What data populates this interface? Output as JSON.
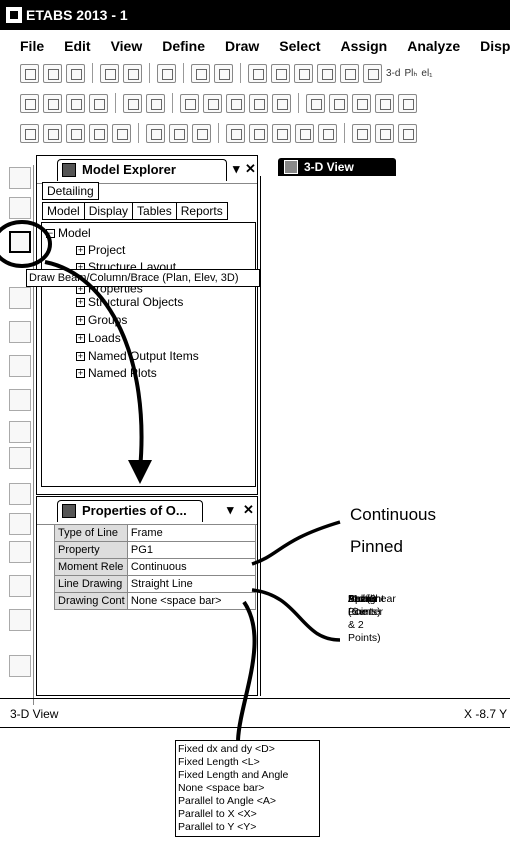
{
  "window": {
    "title": "ETABS 2013  - 1"
  },
  "menu": [
    "File",
    "Edit",
    "View",
    "Define",
    "Draw",
    "Select",
    "Assign",
    "Analyze",
    "Display"
  ],
  "toolbar": {
    "view_3d": "3-d",
    "plan": "Plₕ",
    "elev": "el₁"
  },
  "model_explorer": {
    "title": "Model Explorer",
    "pin": "▾",
    "close": "✕",
    "tab_detailing": "Detailing",
    "tabs": [
      "Model",
      "Display",
      "Tables",
      "Reports"
    ],
    "root": "Model",
    "nodes": [
      "Project",
      "Structure Layout",
      "Properties",
      "Structural Objects",
      "Groups",
      "Loads",
      "Named Output Items",
      "Named Plots"
    ]
  },
  "tooltip": "Draw Beam/Column/Brace (Plan, Elev, 3D)",
  "view_tab": "3-D View",
  "properties": {
    "title": "Properties of O...",
    "pin": "▾",
    "close": "✕",
    "rows": [
      {
        "k": "Type of Line",
        "v": "Frame"
      },
      {
        "k": "Property",
        "v": "PG1"
      },
      {
        "k": "Moment Rele",
        "v": "Continuous"
      },
      {
        "k": "Line Drawing",
        "v": "Straight Line"
      },
      {
        "k": "Drawing Cont",
        "v": "None  <space bar>"
      }
    ]
  },
  "statusbar": {
    "left": "3-D View",
    "right": "X -8.7 Y"
  },
  "annotations": {
    "moment_options": [
      "Continuous",
      "Pinned"
    ],
    "line_options": [
      "Arc (3  Points)",
      "Arc (Center & 2  Points)",
      "Bezier",
      "Multilinear",
      "Spline",
      "Straight Line"
    ]
  },
  "dropdown": {
    "items": [
      "Fixed dx and dy  <D>",
      "Fixed Length  <L>",
      "Fixed Length and Angle",
      "None  <space bar>",
      "Parallel to Angle  <A>",
      "Parallel to X  <X>",
      "Parallel to Y  <Y>"
    ]
  }
}
